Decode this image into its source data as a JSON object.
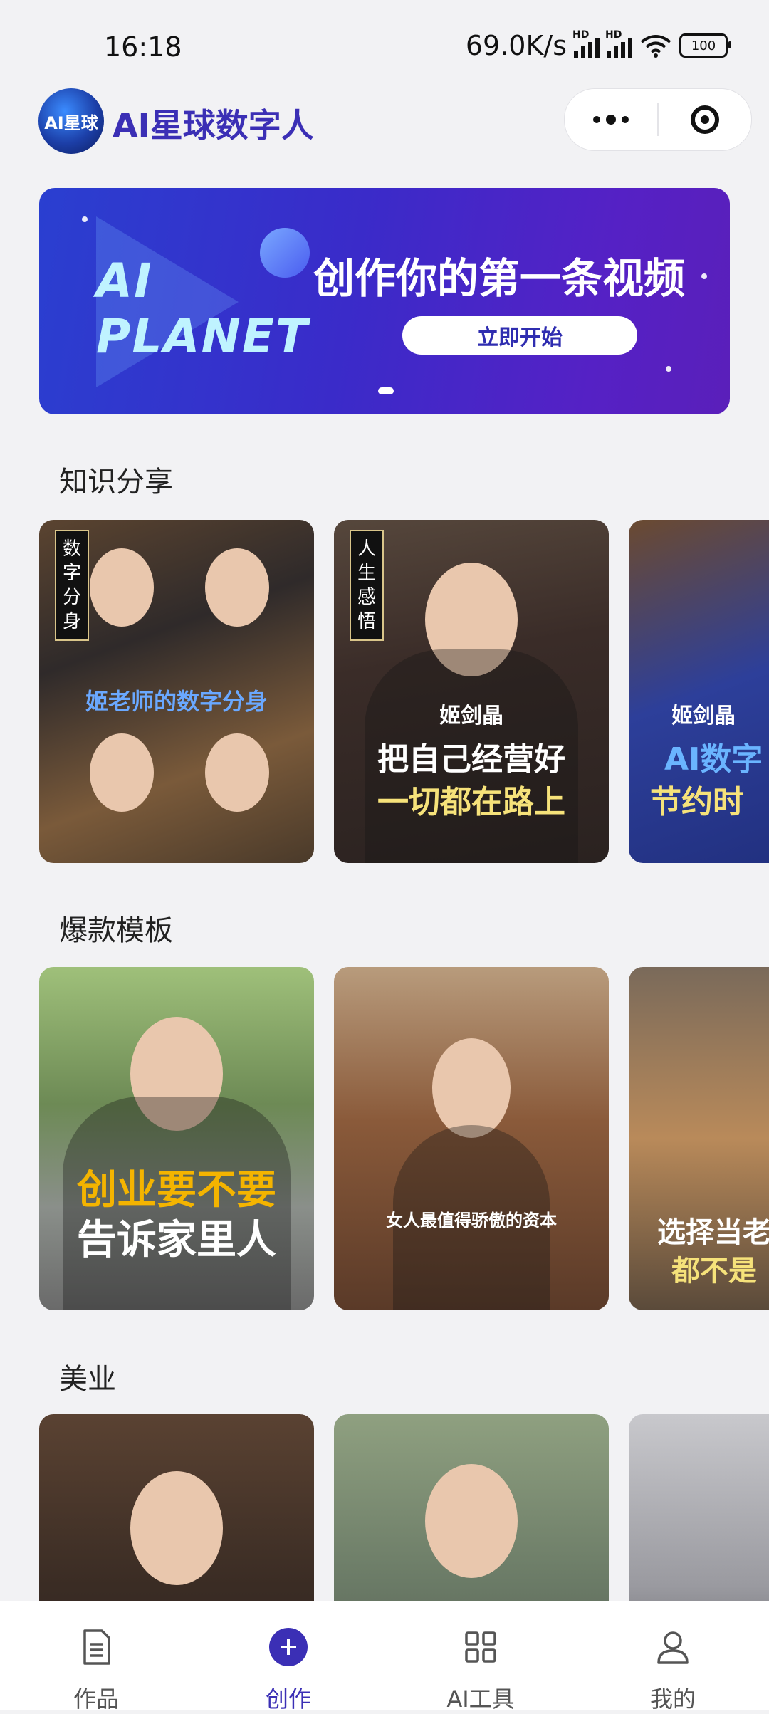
{
  "status_bar": {
    "time": "16:18",
    "net_speed": "69.0K/s",
    "battery": "100"
  },
  "header": {
    "logo_text": "AI星球",
    "title": "AI星球数字人"
  },
  "banner": {
    "brand_line1": "AI",
    "brand_line2": "PLANET",
    "headline": "创作你的第一条视频",
    "cta": "立即开始"
  },
  "sections": [
    {
      "title": "知识分享",
      "cards": [
        {
          "tag": "数字分身",
          "caption_top": "",
          "caption_main": "姬老师的数字分身",
          "caption_sub": ""
        },
        {
          "tag": "人生感悟",
          "caption_top": "姬剑晶",
          "caption_main": "把自己经营好",
          "caption_sub": "一切都在路上"
        },
        {
          "tag": "",
          "caption_top": "姬剑晶",
          "caption_main": "AI数字",
          "caption_sub": "节约时"
        }
      ]
    },
    {
      "title": "爆款模板",
      "cards": [
        {
          "caption_top": "",
          "caption_main": "创业要不要",
          "caption_sub": "告诉家里人"
        },
        {
          "caption_top": "",
          "caption_main": "女人最值得骄傲的资本",
          "caption_sub": ""
        },
        {
          "caption_top": "",
          "caption_main": "选择当老",
          "caption_sub": "都不是"
        }
      ]
    },
    {
      "title": "美业",
      "cards": [
        {},
        {},
        {}
      ]
    }
  ],
  "tabbar": {
    "items": [
      {
        "label": "作品",
        "icon": "document-icon"
      },
      {
        "label": "创作",
        "icon": "plus-circle-icon"
      },
      {
        "label": "AI工具",
        "icon": "grid-icon"
      },
      {
        "label": "我的",
        "icon": "user-icon"
      }
    ],
    "active": 1,
    "accent_color": "#3b2fb5"
  }
}
